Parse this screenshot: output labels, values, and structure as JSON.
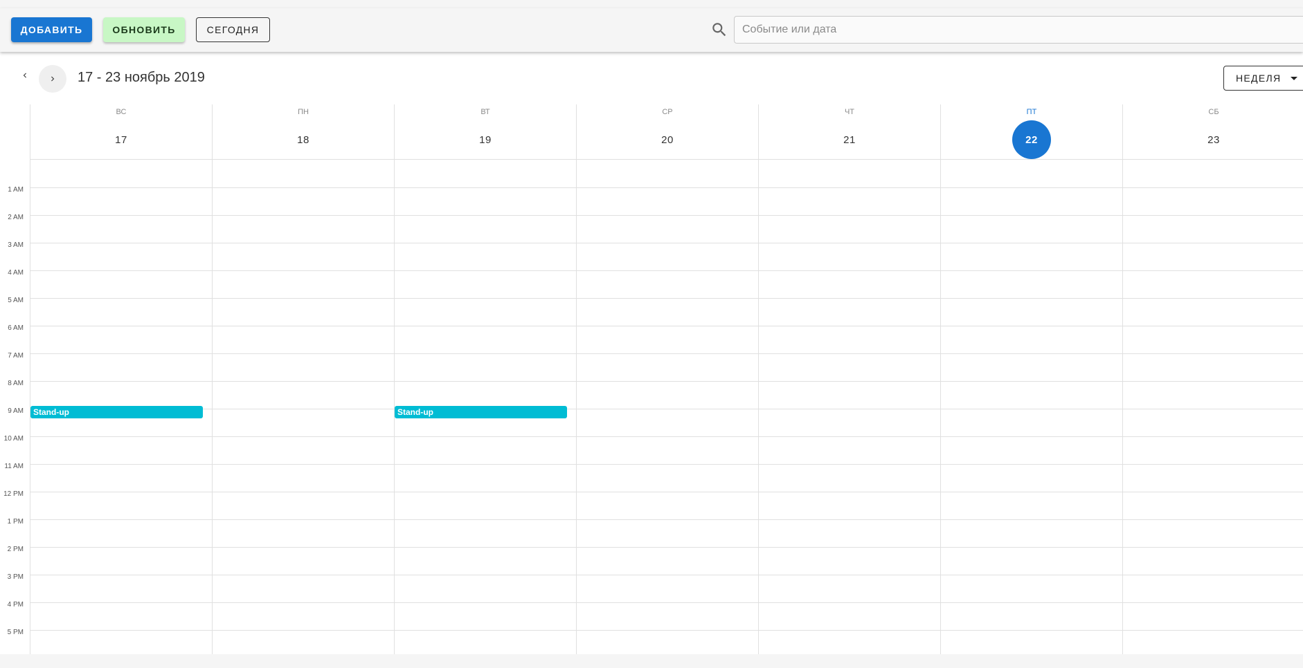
{
  "toolbar": {
    "add_label": "Добавить",
    "refresh_label": "Обновить",
    "today_label": "Сегодня",
    "search_placeholder": "Событие или дата",
    "search_value": ""
  },
  "calendar": {
    "period_title": "17 - 23 ноябрь 2019",
    "view_label": "Неделя",
    "days": [
      {
        "name": "Вс",
        "num": "17",
        "today": false
      },
      {
        "name": "Пн",
        "num": "18",
        "today": false
      },
      {
        "name": "Вт",
        "num": "19",
        "today": false
      },
      {
        "name": "Ср",
        "num": "20",
        "today": false
      },
      {
        "name": "Чт",
        "num": "21",
        "today": false
      },
      {
        "name": "Пт",
        "num": "22",
        "today": true
      },
      {
        "name": "Сб",
        "num": "23",
        "today": false
      }
    ],
    "hours": [
      "1 AM",
      "2 AM",
      "3 AM",
      "4 AM",
      "5 AM",
      "6 AM",
      "7 AM",
      "8 AM",
      "9 AM",
      "10 AM",
      "11 AM",
      "12 PM",
      "1 PM",
      "2 PM",
      "3 PM",
      "4 PM",
      "5 PM"
    ],
    "events": [
      {
        "title": "Stand-up",
        "day_index": 0,
        "start_hour": 8.9
      },
      {
        "title": "Stand-up",
        "day_index": 2,
        "start_hour": 8.9
      }
    ]
  },
  "colors": {
    "primary": "#1976d2",
    "refresh_bg": "#c8f7c5",
    "event": "#00bcd4"
  }
}
